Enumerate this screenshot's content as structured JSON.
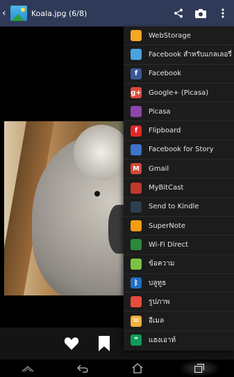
{
  "header": {
    "title": "Koala.jpg (6/8)",
    "back_glyph": "‹"
  },
  "share_menu": {
    "items": [
      {
        "label": "WebStorage",
        "icon": "webstorage-icon",
        "color": "#f5a623",
        "glyph": ""
      },
      {
        "label": "Facebook สำหรับแกลเลอรี่",
        "icon": "facebook-gallery-icon",
        "color": "#4aa3df",
        "glyph": ""
      },
      {
        "label": "Facebook",
        "icon": "facebook-icon",
        "color": "#3b5998",
        "glyph": "f"
      },
      {
        "label": "Google+ (Picasa)",
        "icon": "google-plus-icon",
        "color": "#dd4b39",
        "glyph": "g+"
      },
      {
        "label": "Picasa",
        "icon": "picasa-icon",
        "color": "#8e44ad",
        "glyph": ""
      },
      {
        "label": "Flipboard",
        "icon": "flipboard-icon",
        "color": "#e12828",
        "glyph": "f"
      },
      {
        "label": "Facebook for Story",
        "icon": "facebook-story-icon",
        "color": "#3b74c8",
        "glyph": ""
      },
      {
        "label": "Gmail",
        "icon": "gmail-icon",
        "color": "#d14836",
        "glyph": "M"
      },
      {
        "label": "MyBitCast",
        "icon": "mybitcast-icon",
        "color": "#c0392b",
        "glyph": ""
      },
      {
        "label": "Send to Kindle",
        "icon": "kindle-icon",
        "color": "#2c3e50",
        "glyph": ""
      },
      {
        "label": "SuperNote",
        "icon": "supernote-icon",
        "color": "#f39c12",
        "glyph": ""
      },
      {
        "label": "Wi-Fi Direct",
        "icon": "wifi-direct-icon",
        "color": "#2d8a3a",
        "glyph": ""
      },
      {
        "label": "ข้อความ",
        "icon": "messaging-icon",
        "color": "#7cc242",
        "glyph": ""
      },
      {
        "label": "บลูทูธ",
        "icon": "bluetooth-icon",
        "color": "#1f6fbf",
        "glyph": "ᛒ"
      },
      {
        "label": "รูปภาพ",
        "icon": "photos-icon",
        "color": "#e74c3c",
        "glyph": ""
      },
      {
        "label": "อีเมล",
        "icon": "email-icon",
        "color": "#f5b041",
        "glyph": "✉"
      },
      {
        "label": "แฮงเอาท์",
        "icon": "hangouts-icon",
        "color": "#0f9d58",
        "glyph": "❞"
      }
    ]
  }
}
